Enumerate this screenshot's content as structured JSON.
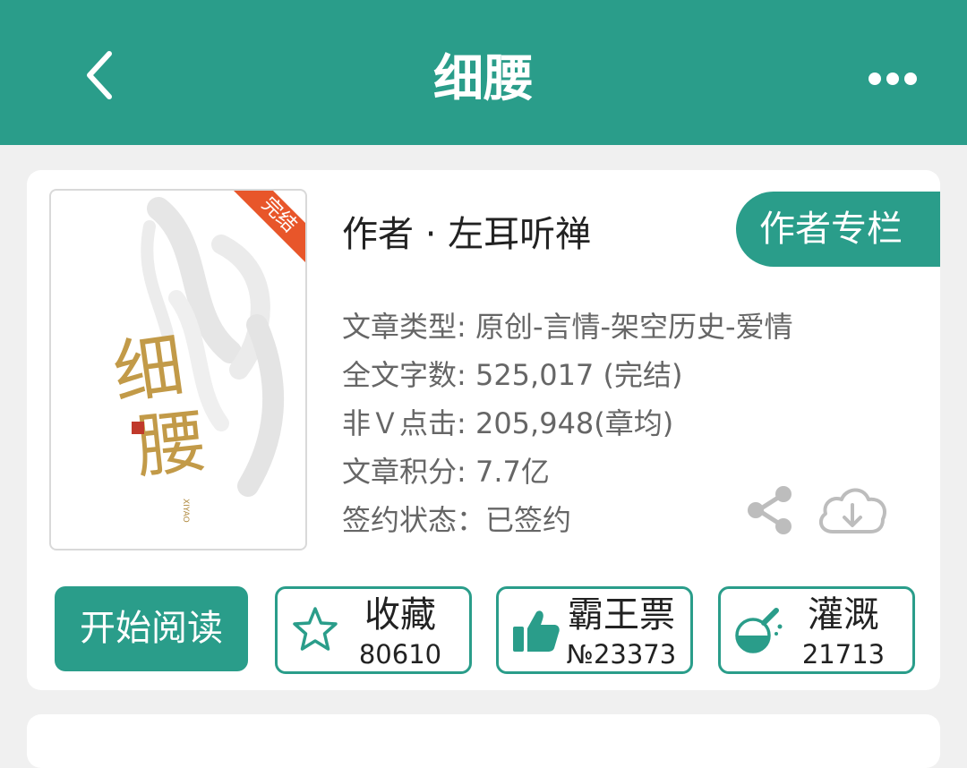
{
  "header": {
    "title": "细腰"
  },
  "book": {
    "status_ribbon": "完结",
    "cover_text": "细腰",
    "cover_subtext": "XIYAO",
    "author_line": "作者 · 左耳听禅",
    "author_column_label": "作者专栏",
    "info": [
      "文章类型: 原创-言情-架空历史-爱情",
      "全文字数: 525,017 (完结)",
      "非Ｖ点击: 205,948(章均)",
      "文章积分: 7.7亿",
      "签约状态：已签约"
    ]
  },
  "actions": {
    "read_label": "开始阅读",
    "favorite": {
      "label": "收藏",
      "count": "80610"
    },
    "vote": {
      "label": "霸王票",
      "count": "№23373"
    },
    "nutrient": {
      "label": "灌溉",
      "count": "21713"
    }
  },
  "icons": {
    "back": "chevron-left-icon",
    "more": "more-dots-icon",
    "share": "share-icon",
    "download": "cloud-download-icon",
    "favorite": "star-icon",
    "vote": "thumbs-up-icon",
    "nutrient": "flask-icon"
  },
  "colors": {
    "accent": "#2a9d8a",
    "ribbon": "#e8562a",
    "gold": "#c29a48"
  }
}
